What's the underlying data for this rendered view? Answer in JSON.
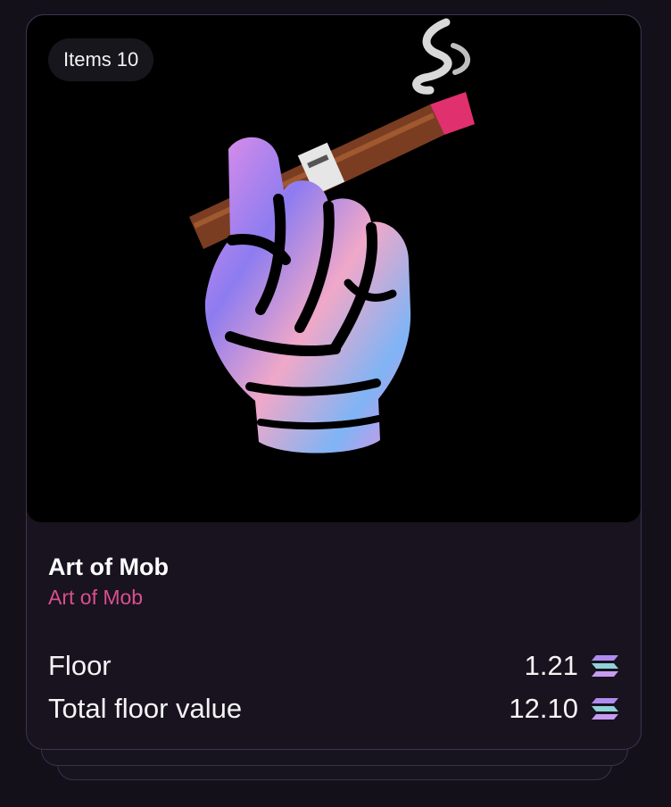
{
  "collection": {
    "items_label": "Items",
    "items_count": "10",
    "title": "Art of Mob",
    "subtitle": "Art of Mob",
    "artwork_icon": "fist-with-cigar-artwork"
  },
  "stats": [
    {
      "label": "Floor",
      "value": "1.21",
      "currency_icon": "solana-icon"
    },
    {
      "label": "Total floor value",
      "value": "12.10",
      "currency_icon": "solana-icon"
    }
  ],
  "colors": {
    "background": "#13101a",
    "card": "#18131f",
    "subtitle_accent": "#d94f8e"
  }
}
